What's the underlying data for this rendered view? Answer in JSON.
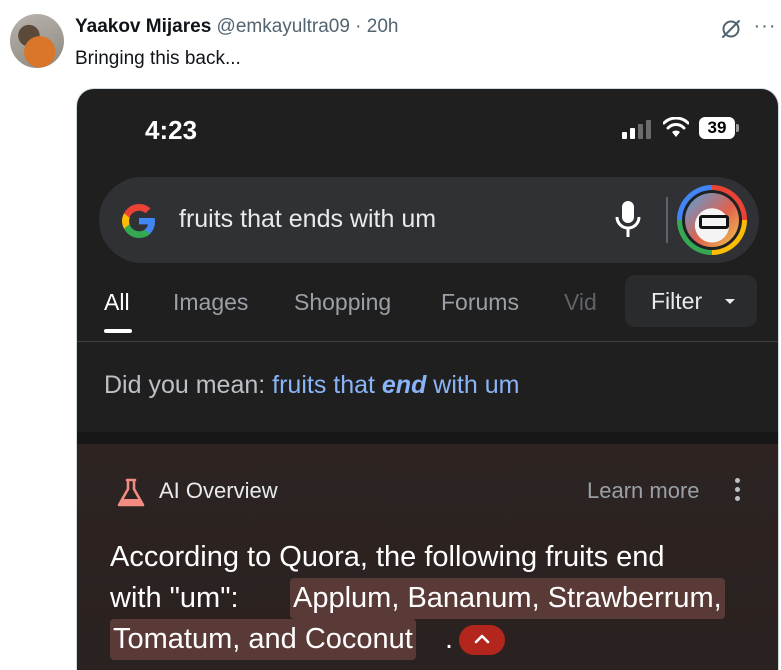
{
  "tweet": {
    "author_name": "Yaakov Mijares",
    "handle": "@emkayultra09",
    "separator": "·",
    "time": "20h",
    "text": "Bringing this back...",
    "more_label": "···"
  },
  "screenshot": {
    "status_bar": {
      "time": "4:23",
      "battery": "39"
    },
    "search": {
      "query": "fruits that ends with um"
    },
    "tabs": [
      {
        "label": "All",
        "active": true
      },
      {
        "label": "Images"
      },
      {
        "label": "Shopping"
      },
      {
        "label": "Forums"
      },
      {
        "label": "Vid"
      }
    ],
    "filter_label": "Filter",
    "did_you_mean": {
      "prefix": "Did you mean: ",
      "suggestion_before": "fruits that ",
      "suggestion_bold": "end",
      "suggestion_after": " with um"
    },
    "ai_overview": {
      "title": "AI Overview",
      "learn_more": "Learn more",
      "line1": "According to Quora, the following fruits end",
      "line2_prefix": "with \"um\": ",
      "highlight_line2": "Applum, Bananum, Strawberrum,",
      "highlight_line3": "Tomatum, and Coconut",
      "line3_suffix": "."
    },
    "colors": {
      "background": "#1f1f1f",
      "link": "#8ab4f8",
      "highlight": "#5a3a36",
      "accent_red": "#b3261e"
    }
  }
}
